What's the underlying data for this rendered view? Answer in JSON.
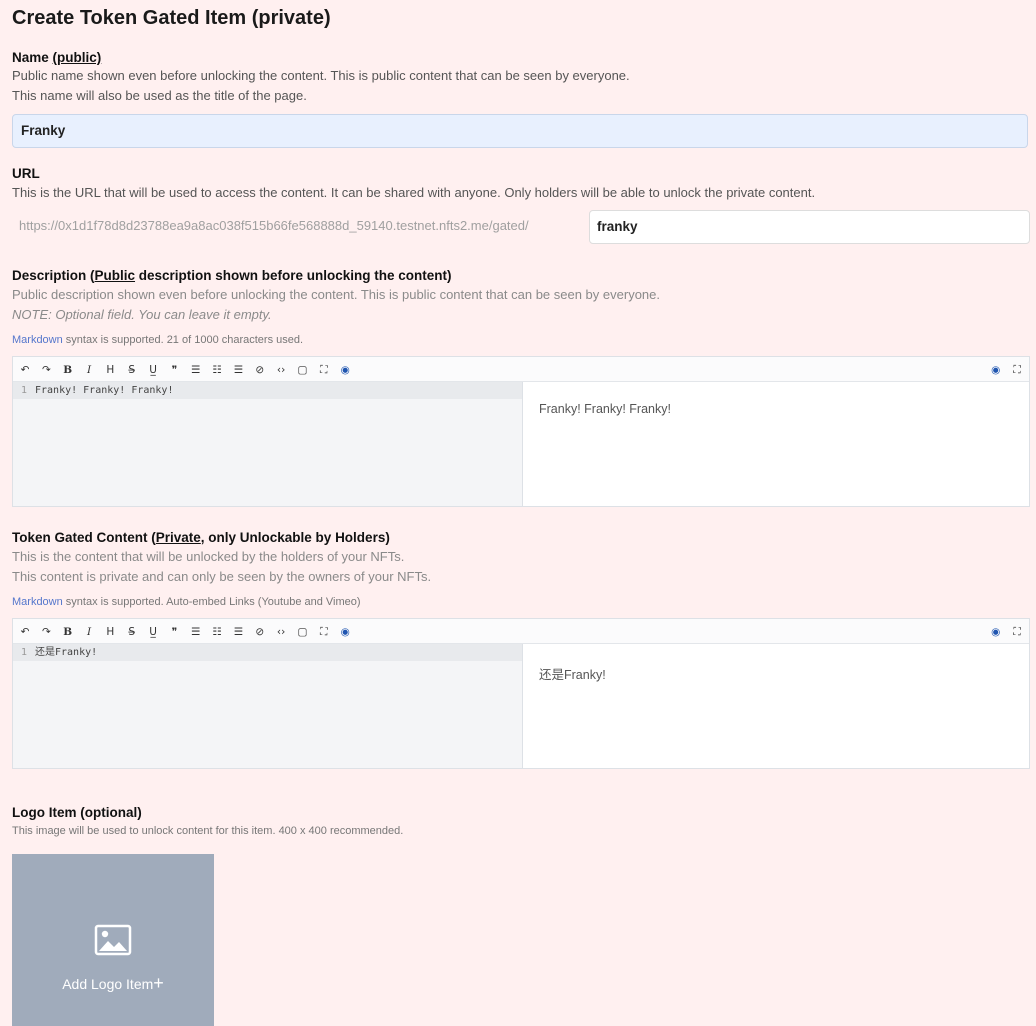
{
  "page": {
    "title": "Create Token Gated Item (private)"
  },
  "name": {
    "label": "Name",
    "label_tag": "(public)",
    "help_1": "Public name shown even before unlocking the content. This is public content that can be seen by everyone.",
    "help_2": "This name will also be used as the title of the page.",
    "value": "Franky"
  },
  "url": {
    "label": "URL",
    "help": "This is the URL that will be used to access the content. It can be shared with anyone. Only holders will be able to unlock the private content.",
    "prefix": "https://0x1d1f78d8d23788ea9a8ac038f515b66fe568888d_59140.testnet.nfts2.me/gated/",
    "value": "franky"
  },
  "description": {
    "label_pre": "Description (",
    "label_public": "Public",
    "label_post": " description shown before unlocking the content)",
    "help_1": "Public description shown even before unlocking the content. This is public content that can be seen by everyone.",
    "note": "NOTE: Optional field. You can leave it empty.",
    "markdown_link": "Markdown",
    "markdown_info": " syntax is supported. 21 of 1000 characters used.",
    "line_no": "1",
    "editor_text": "Franky! Franky! Franky!",
    "preview_text": "Franky!  Franky!  Franky!"
  },
  "gated": {
    "label_pre": "Token Gated Content (",
    "label_private": "Private",
    "label_post": ", only Unlockable by Holders)",
    "help_1": "This is the content that will be unlocked by the holders of your NFTs.",
    "help_2": "This content is private and can only be seen by the owners of your NFTs.",
    "markdown_link": "Markdown",
    "markdown_info": " syntax is supported. Auto-embed Links (Youtube and Vimeo)",
    "line_no": "1",
    "editor_text": "还是Franky!",
    "preview_text": "还是Franky!"
  },
  "toolbar": {
    "undo": "↶",
    "redo": "↷",
    "bold": "B",
    "italic": "I",
    "heading": "H",
    "strike": "S̶",
    "underline": "U̲",
    "quote": "❞",
    "ul": "☰",
    "ol": "☷",
    "task": "☰",
    "link": "⊘",
    "code": "‹›",
    "table": "▢",
    "fullscreen_inner": "⛶",
    "preview": "◉",
    "preview_right": "◉",
    "fullscreen": "⛶"
  },
  "logo": {
    "label": "Logo Item (optional)",
    "help": "This image will be used to unlock content for this item. 400 x 400 recommended.",
    "button": "Add Logo Item",
    "plus": "+"
  }
}
